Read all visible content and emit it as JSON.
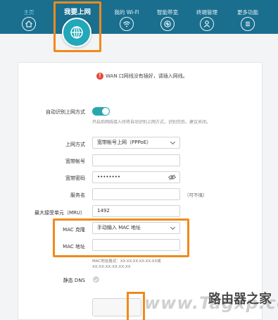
{
  "nav": {
    "home": "主页",
    "internet": "我要上网",
    "wifi": "我的 Wi-Fi",
    "bandwidth": "智能带宽",
    "devices": "终端管理",
    "more": "更多功能"
  },
  "warning": "WAN 口网线没有插好，请插入网线。",
  "form": {
    "auto_label": "自动识别上网方式",
    "auto_hint": "开启后网线接入时将自动识别上网方式，识别完后，建议关闭。",
    "mode_label": "上网方式",
    "mode_value": "宽带帐号上网（PPPoE）",
    "account_label": "宽带帐号",
    "account_value": "",
    "password_label": "宽带密码",
    "password_value": "••••••••",
    "service_label": "服务名",
    "service_value": "",
    "service_optional": "（可不填）",
    "mtu_label": "最大接受单元（MRU）",
    "mtu_value": "1492",
    "mac_clone_label": "MAC 克隆",
    "mac_clone_value": "手动输入 MAC 地址",
    "mac_label": "MAC 地址",
    "mac_value": "",
    "mac_hint": "MAC地址格式：XX-XX-XX-XX-XX-XX或XX:XX:XX:XX:XX:XX",
    "static_dns_label": "静态 DNS"
  },
  "watermark": {
    "url": "www.Tagxp.com",
    "site": "路由器之家"
  },
  "colors": {
    "nav_bg": "#1a6f8f",
    "accent": "#27a6ae",
    "highlight": "#f08a1a",
    "warning": "#e7453a"
  }
}
